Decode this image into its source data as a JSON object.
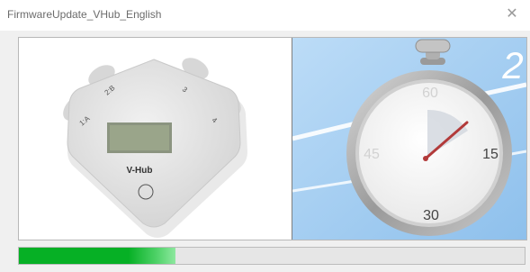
{
  "window": {
    "title": "FirmwareUpdate_VHub_English",
    "close_glyph": "✕"
  },
  "device": {
    "name": "V-Hub",
    "ports": [
      "1:A",
      "2:B",
      "3",
      "4"
    ],
    "body_color": "#e1e1e1",
    "screen_color": "#9aa58a"
  },
  "stopwatch": {
    "countdown": "2",
    "dial_labels": {
      "top": "60",
      "right": "15",
      "bottom": "30",
      "left": "45"
    },
    "background_color": "#a9cff0"
  },
  "progress": {
    "value": 0.31,
    "color": "#06b025"
  }
}
